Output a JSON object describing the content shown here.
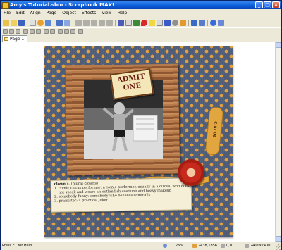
{
  "window": {
    "title": "Amy's Tutorial.sbm - Scrapbook MAX!"
  },
  "menu": [
    "File",
    "Edit",
    "Align",
    "Page",
    "Object",
    "Effects",
    "View",
    "Help"
  ],
  "tabs": [
    {
      "label": "Page 1"
    }
  ],
  "canvas": {
    "ticket_text": "ADMIT ONE",
    "tag_text": "CIRCUS",
    "definition": {
      "word": "clown",
      "pos": "n. (plural clowns)",
      "lines": [
        "1. comic circus performer: a comic performer, usually in a circus, who does",
        "not speak and wears an outlandish costume and heavy makeup",
        "2. somebody funny: somebody who behaves comically",
        "3. prankster: a practical joker"
      ]
    }
  },
  "status": {
    "help": "Press F1 for Help",
    "zoom": "26%",
    "coords": "2438,1856",
    "size1": "0,0",
    "size2": "2400x2400"
  },
  "colors": {
    "title_bar": "#0c5ad8",
    "paper": "#4f5d78",
    "dots": "#e0a040"
  }
}
